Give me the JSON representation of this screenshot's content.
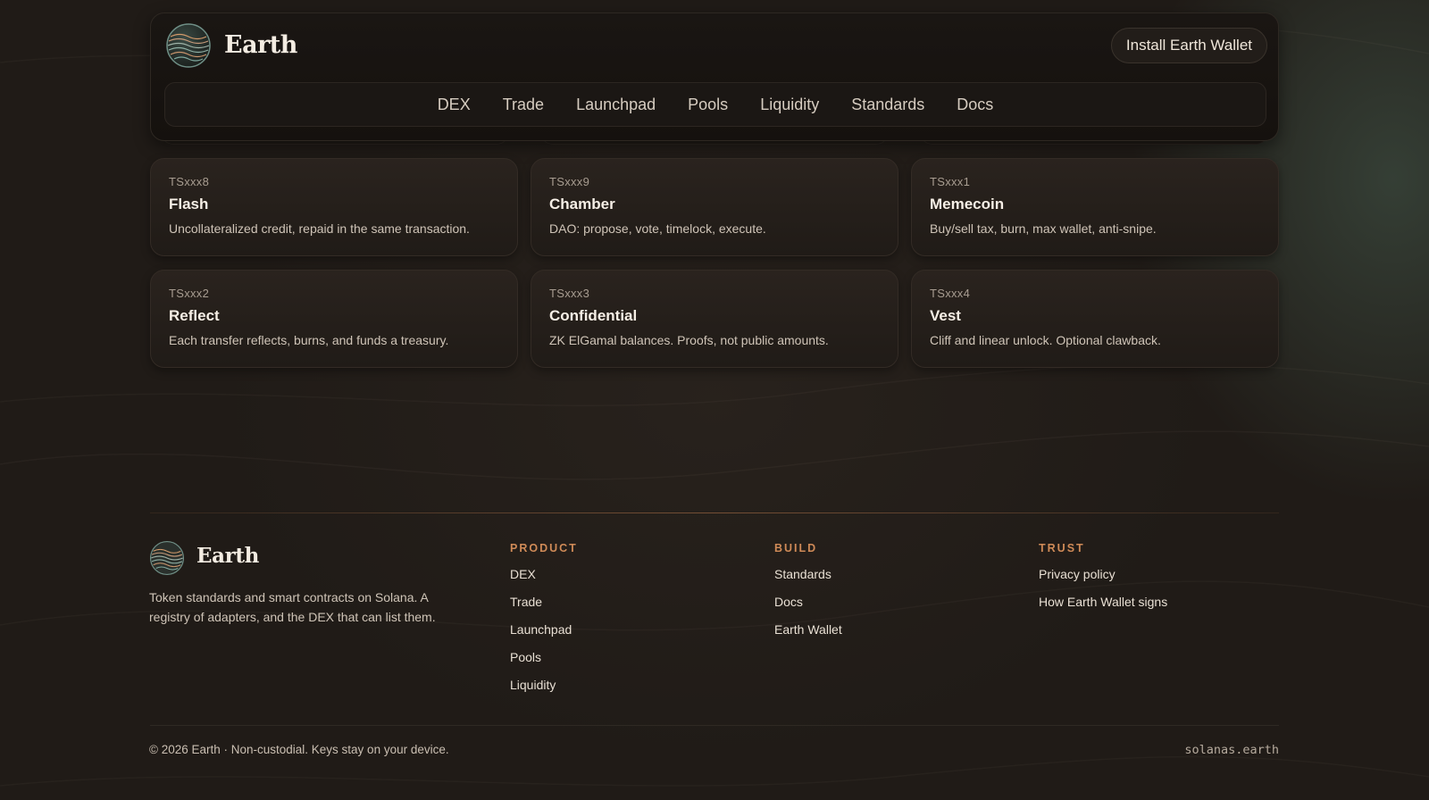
{
  "header": {
    "brand": "Earth",
    "install_button": "Install Earth Wallet",
    "nav": [
      "DEX",
      "Trade",
      "Launchpad",
      "Pools",
      "Liquidity",
      "Standards",
      "Docs"
    ]
  },
  "cards": [
    {
      "code": "TSxxx8",
      "title": "Flash",
      "desc": "Uncollateralized credit, repaid in the same transaction."
    },
    {
      "code": "TSxxx9",
      "title": "Chamber",
      "desc": "DAO: propose, vote, timelock, execute."
    },
    {
      "code": "TSxxx1",
      "title": "Memecoin",
      "desc": "Buy/sell tax, burn, max wallet, anti-snipe."
    },
    {
      "code": "TSxxx2",
      "title": "Reflect",
      "desc": "Each transfer reflects, burns, and funds a treasury."
    },
    {
      "code": "TSxxx3",
      "title": "Confidential",
      "desc": "ZK ElGamal balances. Proofs, not public amounts."
    },
    {
      "code": "TSxxx4",
      "title": "Vest",
      "desc": "Cliff and linear unlock. Optional clawback."
    }
  ],
  "footer": {
    "brand": "Earth",
    "tagline": "Token standards and smart contracts on Solana. A registry of adapters, and the DEX that can list them.",
    "columns": [
      {
        "heading": "PRODUCT",
        "links": [
          "DEX",
          "Trade",
          "Launchpad",
          "Pools",
          "Liquidity"
        ]
      },
      {
        "heading": "BUILD",
        "links": [
          "Standards",
          "Docs",
          "Earth Wallet"
        ]
      },
      {
        "heading": "TRUST",
        "links": [
          "Privacy policy",
          "How Earth Wallet signs"
        ]
      }
    ],
    "copyright": "© 2026 Earth · Non-custodial. Keys stay on your device.",
    "domain": "solanas.earth"
  },
  "colors": {
    "background": "#201b17",
    "accent": "#cf8a57",
    "card": "#2a231e"
  }
}
